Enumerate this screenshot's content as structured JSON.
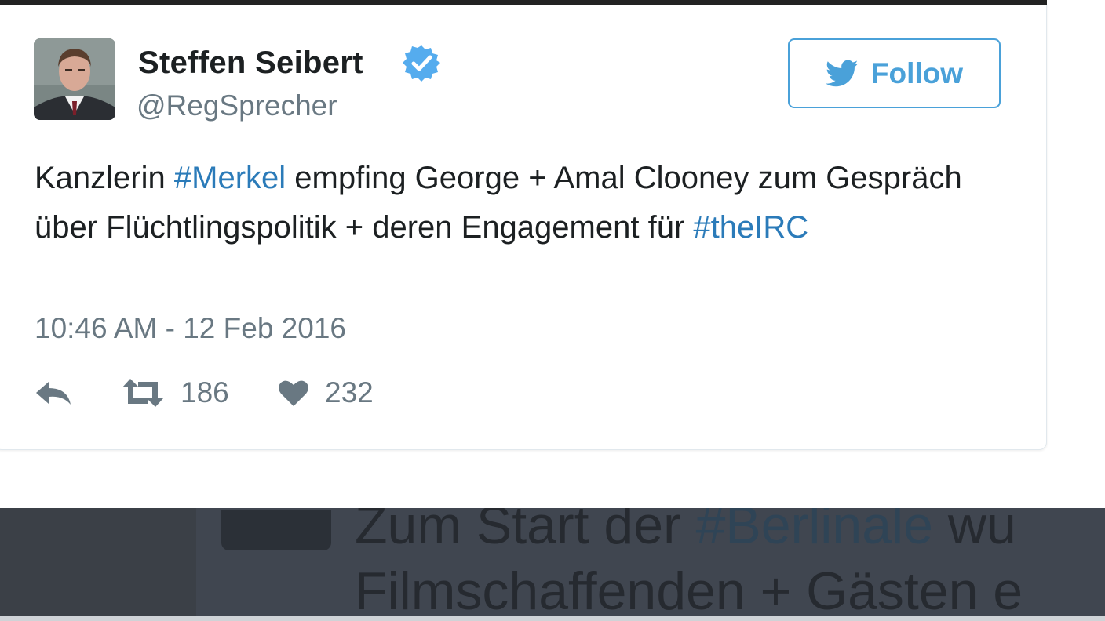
{
  "tweet": {
    "author_name": "Steffen Seibert",
    "author_handle": "@RegSprecher",
    "verified_icon": "verified-badge-icon",
    "follow_label": "Follow",
    "text_parts": [
      "Kanzlerin ",
      "#Merkel",
      " empfing George + Amal Clooney zum Gespräch über Flüchtlingspolitik + deren Engagement für ",
      "#theIRC"
    ],
    "timestamp": "10:46 AM - 12 Feb 2016",
    "retweet_count": "186",
    "like_count": "232"
  },
  "background_tweet": {
    "line1_before": "Zum Start der ",
    "line1_hashtag": "#Berlinale",
    "line1_after": " wu",
    "line2": "Filmschaffenden + Gästen e"
  },
  "colors": {
    "accent": "#4aa1d9",
    "hashtag": "#2b7bb9",
    "name": "#1c2022",
    "muted": "#697882",
    "verified": "#55acee",
    "overlay": "#3b4047"
  }
}
